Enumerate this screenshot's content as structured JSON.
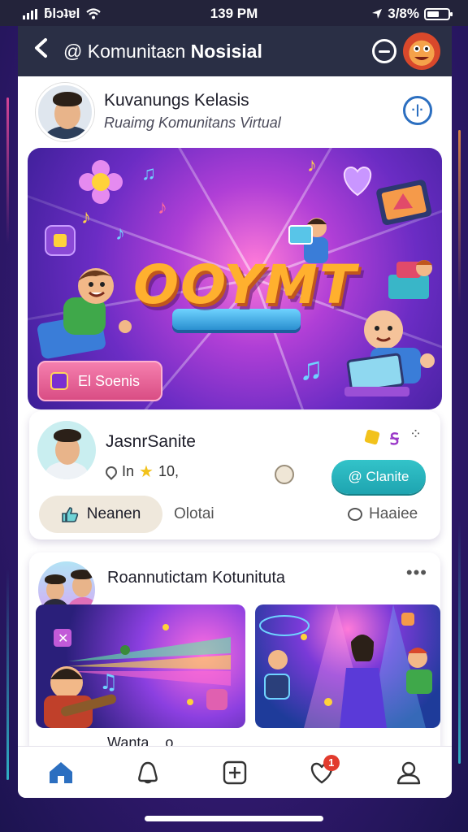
{
  "status_bar": {
    "carrier": "ƖƖ",
    "carrier_text": "ƃlɔʇɐl",
    "time": "139 PM",
    "battery_text": "3/8%"
  },
  "header": {
    "back_symbol": "<",
    "title_prefix": "@ Komunitaɛn",
    "title_bold": "Nosisial"
  },
  "profile": {
    "name": "Kuvanungs Kelasis",
    "subtitle": "Ruaimg Komunitans Virtual",
    "info_symbol": "·|·"
  },
  "banner": {
    "logo_text": "OOYMT",
    "chip_label": "El Soenis"
  },
  "post_card": {
    "name": "JasnrSanite",
    "meta_prefix": "In",
    "meta_value": "10,",
    "pill_label": "@ Clanite",
    "tabs": [
      "Neanen",
      "Olotai",
      "Haaiee"
    ]
  },
  "feed_card": {
    "title": "Roannutictam Kotunituta",
    "more": "•••",
    "caption": "Wanta . .o"
  },
  "bottom_nav": {
    "items": [
      "home",
      "community",
      "create",
      "likes",
      "profile"
    ],
    "likes_badge": "1"
  },
  "colors": {
    "accent": "#2c6fc0",
    "header_bg": "#2a2f45",
    "badge": "#e23b2e",
    "pill": "#1ea4b0"
  }
}
